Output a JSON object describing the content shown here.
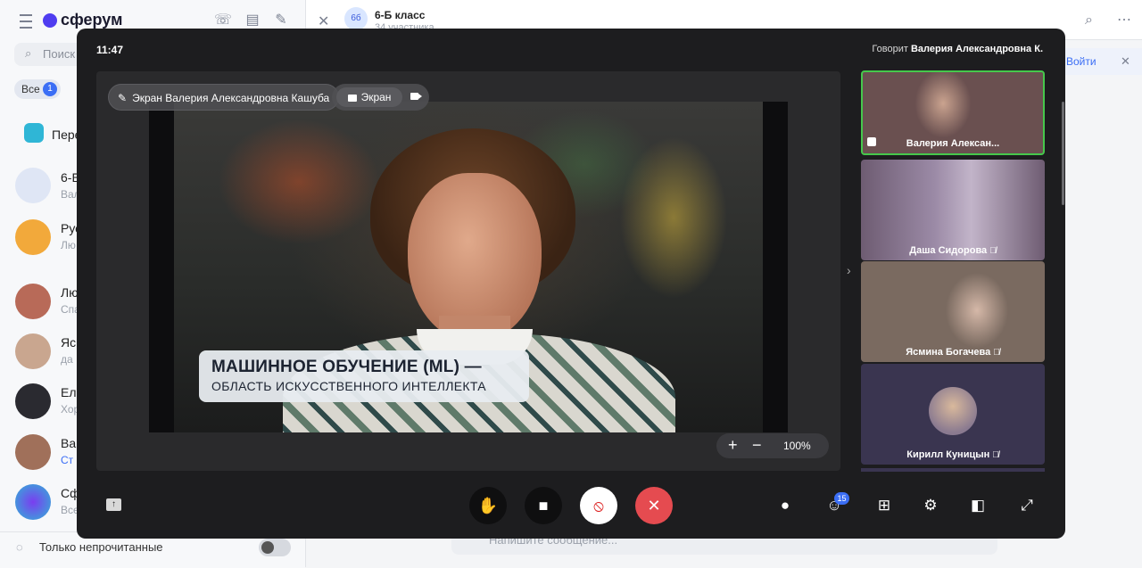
{
  "app": {
    "logo": "сферум",
    "search_placeholder": "Поиск",
    "filter_all": "Все",
    "filter_all_count": "1",
    "unread_only_label": "Только непрочитанные",
    "chat_title": "6-Б класс",
    "chat_subtitle": "34 участника",
    "group_avatar": "6б",
    "banner_action": "Войти",
    "message_placeholder": "Напишите сообщение...",
    "chats": [
      {
        "name": "Пере",
        "sub": ""
      },
      {
        "name": "6-Б",
        "sub": "Вал"
      },
      {
        "name": "Рус",
        "sub": "Лю"
      },
      {
        "name": "Лю",
        "sub": "Спа"
      },
      {
        "name": "Яс",
        "sub": "да"
      },
      {
        "name": "Ел",
        "sub": "Хор"
      },
      {
        "name": "Ва",
        "sub": "Ст"
      },
      {
        "name": "Сф",
        "sub": "Все"
      }
    ]
  },
  "call": {
    "time": "11:47",
    "speaking_prefix": "Говорит",
    "speaking_name": "Валерия Александровна К.",
    "screen_label": "Экран Валерия Александровна Кашуба",
    "mode_screen": "Экран",
    "caption_line1": "МАШИННОЕ ОБУЧЕНИЕ (ML) —",
    "caption_line2": "ОБЛАСТЬ ИСКУССТВЕННОГО ИНТЕЛЛЕКТА",
    "zoom_plus": "+",
    "zoom_minus": "−",
    "zoom_level": "100%",
    "participants_count": "15",
    "participants": [
      {
        "name": "Валерия Алексан...",
        "muted": false,
        "speaking": true
      },
      {
        "name": "Даша Сидорова",
        "muted": true
      },
      {
        "name": "Ясмина Богачева",
        "muted": true
      },
      {
        "name": "Кирилл Куницын",
        "muted": true
      }
    ]
  },
  "colors": {
    "speaking_border": "#46c84c",
    "end_call": "#e54b50",
    "badge": "#3b6ef5"
  }
}
